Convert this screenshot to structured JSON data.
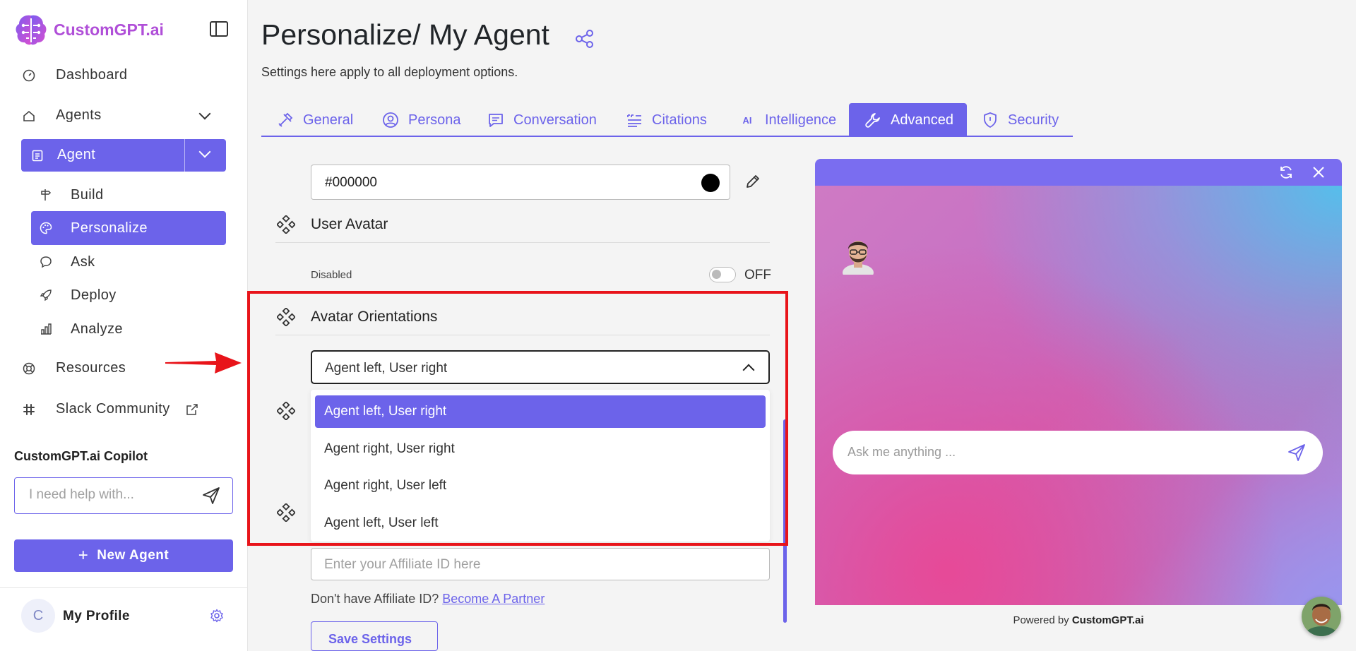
{
  "brand": {
    "name": "CustomGPT.ai",
    "accent": "#6c63ea",
    "logo_color": "#b04fd8"
  },
  "sidebar": {
    "items": [
      {
        "label": "Dashboard",
        "icon": "gauge-icon"
      },
      {
        "label": "Agents",
        "icon": "home-icon"
      },
      {
        "label": "Agent",
        "icon": "clipboard-icon"
      },
      {
        "label": "Resources",
        "icon": "lifebuoy-icon"
      },
      {
        "label": "Slack Community",
        "icon": "slack-icon"
      }
    ],
    "sub_items": [
      {
        "label": "Build",
        "icon": "signpost-icon"
      },
      {
        "label": "Personalize",
        "icon": "palette-icon"
      },
      {
        "label": "Ask",
        "icon": "chat-icon"
      },
      {
        "label": "Deploy",
        "icon": "rocket-icon"
      },
      {
        "label": "Analyze",
        "icon": "bar-chart-icon"
      }
    ],
    "copilot": {
      "title": "CustomGPT.ai Copilot",
      "placeholder": "I need help with..."
    },
    "new_agent_label": "New Agent",
    "profile": {
      "initial": "C",
      "name": "My Profile"
    }
  },
  "page": {
    "title": "Personalize/ My Agent",
    "subtitle": "Settings here apply to all deployment options."
  },
  "tabs": [
    {
      "label": "General",
      "icon": "tools-icon"
    },
    {
      "label": "Persona",
      "icon": "user-circle-icon"
    },
    {
      "label": "Conversation",
      "icon": "message-icon"
    },
    {
      "label": "Citations",
      "icon": "quote-list-icon"
    },
    {
      "label": "Intelligence",
      "icon": "ai-icon"
    },
    {
      "label": "Advanced",
      "icon": "wrench-icon",
      "active": true
    },
    {
      "label": "Security",
      "icon": "shield-icon"
    }
  ],
  "settings": {
    "color_value": "#000000",
    "user_avatar": {
      "heading": "User Avatar",
      "status_label": "Disabled",
      "toggle_text": "OFF"
    },
    "avatar_orientations": {
      "heading": "Avatar Orientations",
      "selected": "Agent left, User right",
      "options": [
        "Agent left, User right",
        "Agent right, User right",
        "Agent right, User left",
        "Agent left, User left"
      ]
    },
    "affiliate": {
      "placeholder": "Enter your Affiliate ID here",
      "note": "Don't have Affiliate ID?",
      "link": "Become A Partner"
    },
    "save_label": "Save Settings"
  },
  "preview": {
    "ask_placeholder": "Ask me anything ...",
    "powered_prefix": "Powered by",
    "powered_brand": "CustomGPT.ai"
  }
}
